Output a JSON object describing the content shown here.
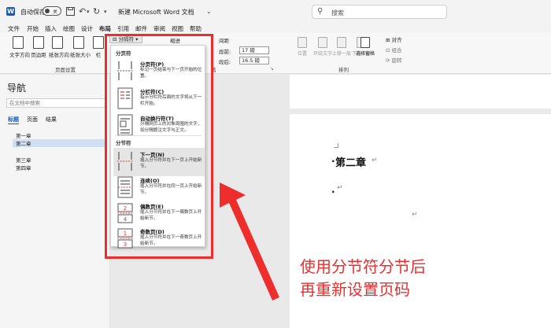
{
  "titlebar": {
    "autosave_label": "自动保存",
    "autosave_state": "关",
    "doc_title": "新建 Microsoft Word 文档",
    "search_placeholder": "搜索"
  },
  "tabs": [
    "文件",
    "开始",
    "插入",
    "绘图",
    "设计",
    "布局",
    "引用",
    "邮件",
    "审阅",
    "视图",
    "帮助"
  ],
  "active_tab": "布局",
  "ribbon": {
    "buttons": [
      "文字方向",
      "页边距",
      "纸张方向",
      "纸张大小",
      "栏"
    ],
    "breaks_label": "分隔符",
    "indent_label": "缩进",
    "spacing_label": "间距",
    "before_label": "段前:",
    "before_value": "17 磅",
    "after_label": "段后:",
    "after_value": "16.5 磅",
    "group_page_setup": "页面设置",
    "group_paragraph": "落",
    "group_arrange": "排列",
    "arrange_buttons": [
      "位置",
      "环绕文字",
      "上移一层",
      "下移一层",
      "选择窗格"
    ],
    "arrange_small": [
      "对齐",
      "组合",
      "旋转"
    ]
  },
  "nav": {
    "title": "导航",
    "search_placeholder": "在文档中搜索",
    "tabs": [
      "标题",
      "页面",
      "结果"
    ],
    "items": [
      "第一章",
      "第二章",
      "第三章",
      "第四章"
    ]
  },
  "dropdown": {
    "page_breaks_header": "分页符",
    "section_breaks_header": "分节符",
    "items": [
      {
        "title": "分页符(P)",
        "desc": "标记一页结束与下一页开始的位置。"
      },
      {
        "title": "分栏符(C)",
        "desc": "指示分栏符后面的文字将从下一栏开始。"
      },
      {
        "title": "自动换行符(T)",
        "desc": "分隔网页上的对象周围的文字，如分隔题注文字与正文。"
      },
      {
        "title": "下一页(N)",
        "desc": "插入分节符并在下一页上开始新节。"
      },
      {
        "title": "连续(O)",
        "desc": "插入分节符并在同一页上开始新节。"
      },
      {
        "title": "偶数页(E)",
        "desc": "插入分节符并在下一偶数页上开始新节。"
      },
      {
        "title": "奇数页(D)",
        "desc": "插入分节符并在下一奇数页上开始新节。"
      }
    ]
  },
  "document": {
    "heading": "第二章",
    "para_mark": "↵"
  },
  "annotation": {
    "line1": "使用分节符分节后",
    "line2": "再重新设置页码"
  },
  "colors": {
    "accent": "#185abd",
    "annotation_red": "#ee2d2d"
  }
}
